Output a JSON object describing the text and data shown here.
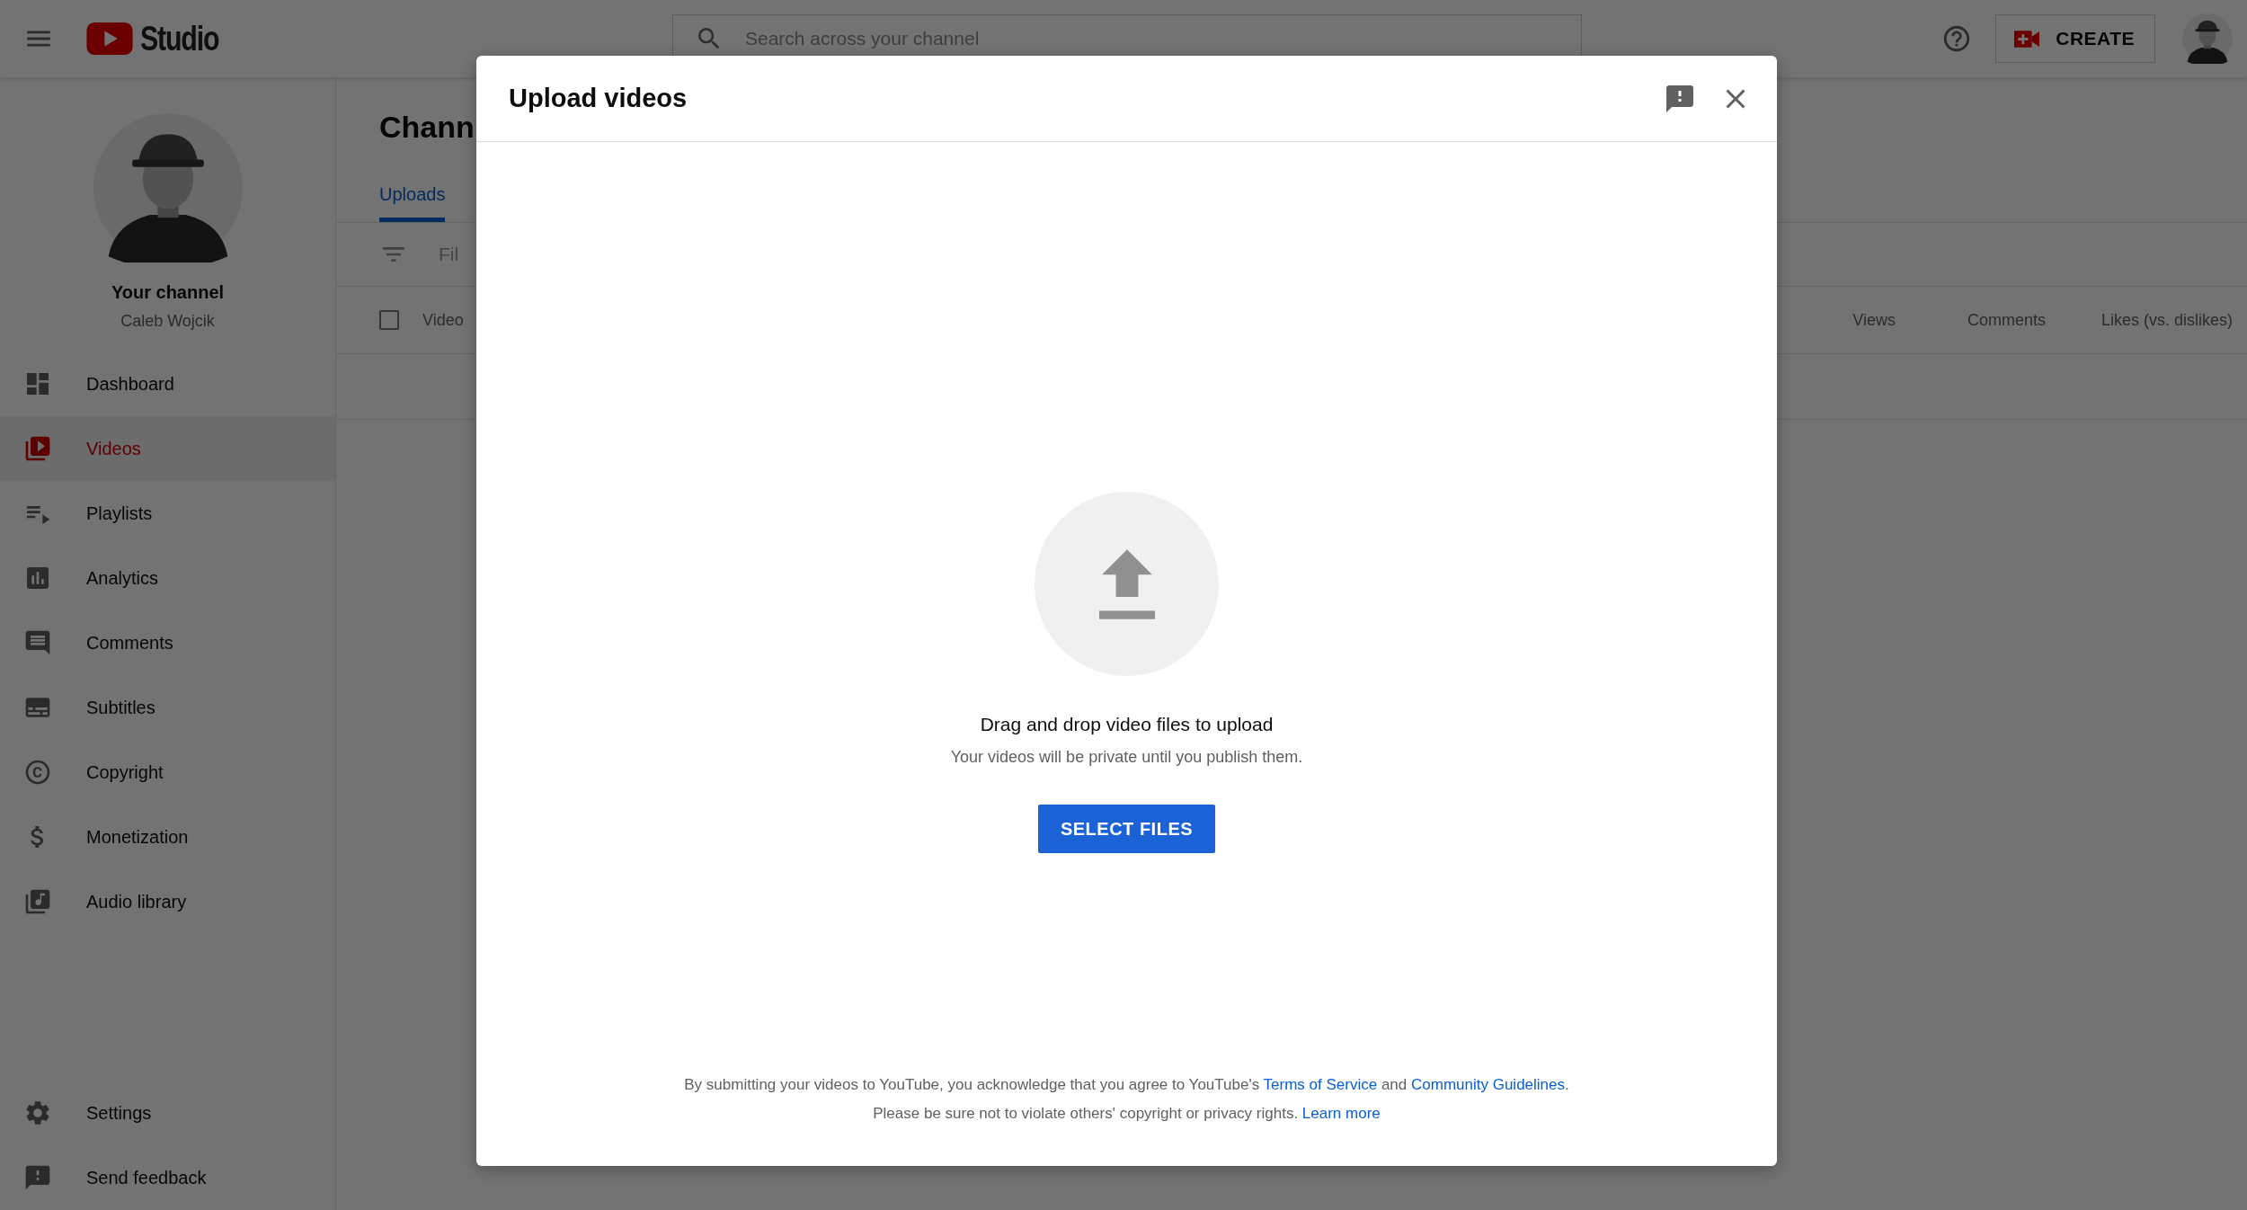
{
  "topbar": {
    "logo_text": "Studio",
    "search": {
      "placeholder": "Search across your channel"
    },
    "create_button": "CREATE"
  },
  "sidebar": {
    "channel_title": "Your channel",
    "channel_name": "Caleb Wojcik",
    "items": [
      {
        "label": "Dashboard",
        "selected": false
      },
      {
        "label": "Videos",
        "selected": true
      },
      {
        "label": "Playlists",
        "selected": false
      },
      {
        "label": "Analytics",
        "selected": false
      },
      {
        "label": "Comments",
        "selected": false
      },
      {
        "label": "Subtitles",
        "selected": false
      },
      {
        "label": "Copyright",
        "selected": false
      },
      {
        "label": "Monetization",
        "selected": false
      },
      {
        "label": "Audio library",
        "selected": false
      }
    ],
    "footer_items": [
      {
        "label": "Settings",
        "selected": false
      },
      {
        "label": "Send feedback",
        "selected": false
      }
    ]
  },
  "content": {
    "title": "Chann",
    "tabs": [
      {
        "label": "Uploads",
        "selected": true
      }
    ],
    "filter": {
      "placeholder": "Fil"
    },
    "table": {
      "select_all_checked": false,
      "columns": [
        "Video",
        "Views",
        "Comments",
        "Likes (vs. dislikes)"
      ]
    }
  },
  "dialog": {
    "title": "Upload videos",
    "heading": "Drag and drop video files to upload",
    "subtext": "Your videos will be private until you publish them.",
    "button": "SELECT FILES",
    "terms": [
      [
        {
          "kind": "text",
          "text": "By submitting your videos to YouTube, you acknowledge that you agree to YouTube's "
        },
        {
          "kind": "link",
          "text": "Terms of Service"
        },
        {
          "kind": "text",
          "text": " and "
        },
        {
          "kind": "link",
          "text": "Community Guidelines"
        },
        {
          "kind": "text",
          "text": "."
        }
      ],
      [
        {
          "kind": "text",
          "text": "Please be sure not to violate others' copyright or privacy rights. "
        },
        {
          "kind": "link",
          "text": "Learn more"
        }
      ]
    ]
  }
}
